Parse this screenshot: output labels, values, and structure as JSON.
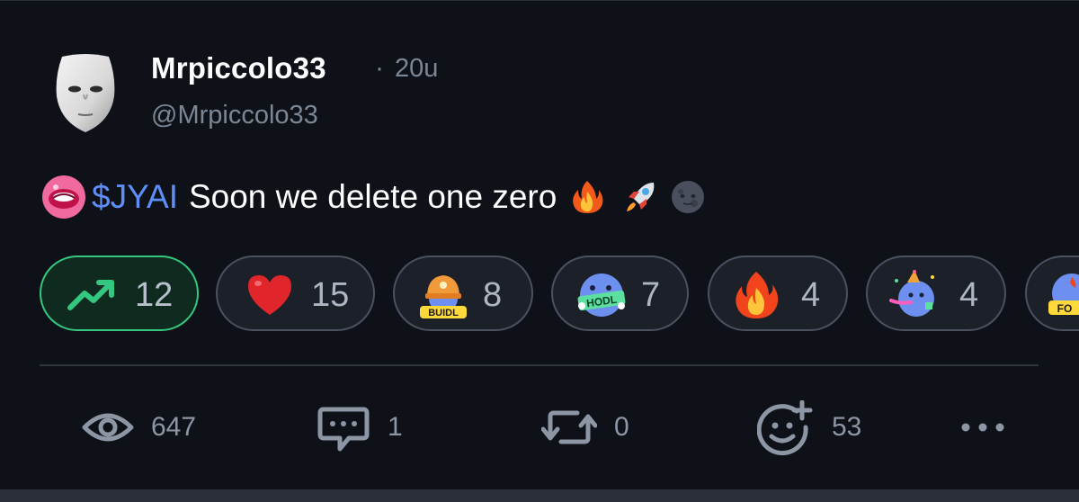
{
  "post": {
    "display_name": "Mrpiccolo33",
    "separator": "·",
    "time": "20u",
    "handle": "@Mrpiccolo33",
    "ticker": "$JYAI",
    "text": "Soon we delete one zero",
    "emojis": [
      "fire",
      "rocket",
      "new-moon-face"
    ]
  },
  "reactions": [
    {
      "name": "trending-up",
      "count": "12",
      "active": true
    },
    {
      "name": "heart",
      "count": "15",
      "active": false
    },
    {
      "name": "buidl",
      "label": "BUIDL",
      "count": "8",
      "active": false
    },
    {
      "name": "hodl",
      "label": "HODL",
      "count": "7",
      "active": false
    },
    {
      "name": "fire",
      "count": "4",
      "active": false
    },
    {
      "name": "party",
      "count": "4",
      "active": false
    },
    {
      "name": "fomo",
      "label": "FO",
      "count": "",
      "active": false
    }
  ],
  "stats": {
    "views": "647",
    "comments": "1",
    "reposts": "0",
    "reactions": "53"
  },
  "colors": {
    "background": "#0e1118",
    "ticker_blue": "#5e8ef7",
    "active_green": "#34c77f",
    "muted_text": "#7c8796"
  }
}
